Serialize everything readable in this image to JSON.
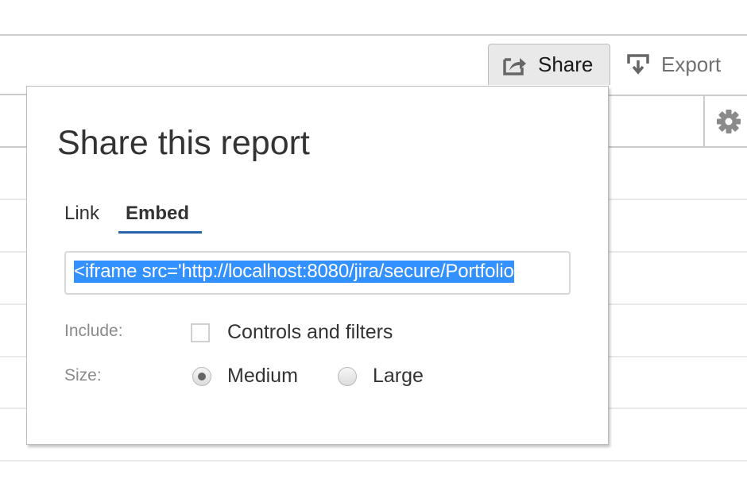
{
  "toolbar": {
    "share_label": "Share",
    "export_label": "Export",
    "share_icon": "share-icon",
    "export_icon": "export-icon",
    "settings_icon": "gear-icon"
  },
  "share_dialog": {
    "title": "Share this report",
    "tabs": [
      {
        "label": "Link",
        "active": false
      },
      {
        "label": "Embed",
        "active": true
      }
    ],
    "embed_code": "<iframe src='http://localhost:8080/jira/secure/Portfolio",
    "include_label": "Include:",
    "include_option": {
      "label": "Controls and filters",
      "checked": false
    },
    "size_label": "Size:",
    "size_options": [
      {
        "label": "Medium",
        "selected": true
      },
      {
        "label": "Large",
        "selected": false
      }
    ]
  },
  "colors": {
    "accent": "#2a64a8",
    "selection": "#3390ff"
  }
}
